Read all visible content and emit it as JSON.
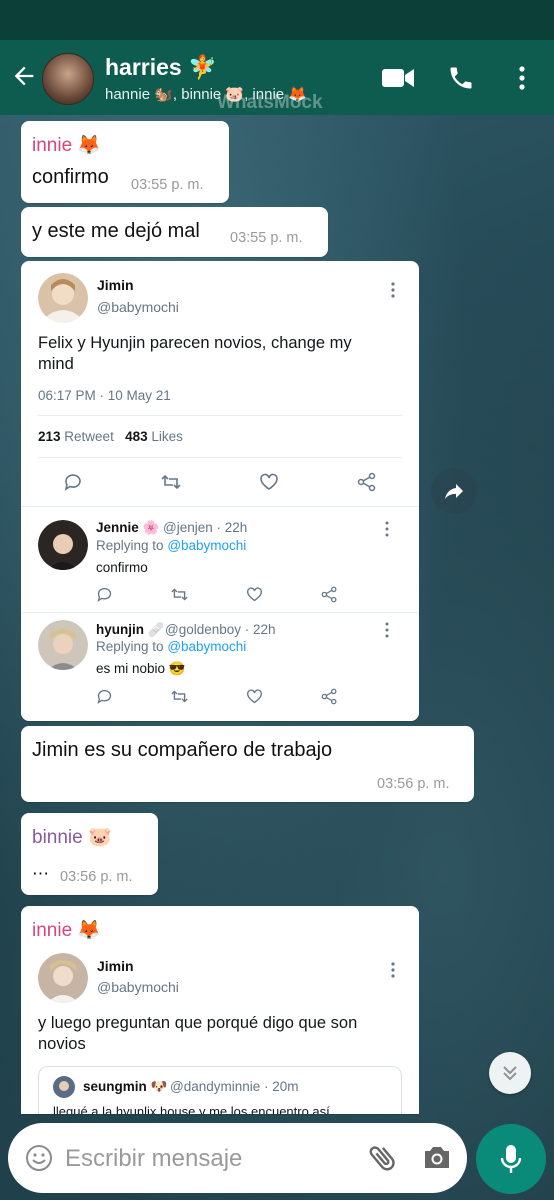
{
  "header": {
    "title": "harries 🧚",
    "subtitle": "hannie 🐿️, binnie 🐷, innie 🦊",
    "watermark": "WhatsMock"
  },
  "colors": {
    "header": "#0d5c4f",
    "status_bar": "#0b3f38",
    "innie_name": "#d6457e",
    "binnie_name": "#8b5a9e",
    "link": "#1da1f2",
    "mic_button": "#0a8a78"
  },
  "messages": {
    "m1": {
      "sender": "innie 🦊",
      "text": "confirmo",
      "time": "03:55 p. m."
    },
    "m2": {
      "text": "y este me dejó mal",
      "time": "03:55 p. m."
    },
    "m3": {
      "text": "Jimin es su compañero de trabajo",
      "time": "03:56 p. m."
    },
    "m4": {
      "sender": "binnie 🐷",
      "text": "⋯",
      "time": "03:56 p. m."
    },
    "m5": {
      "sender": "innie 🦊"
    }
  },
  "tweet1": {
    "name": "Jimin",
    "handle": "@babymochi",
    "text": "Felix y Hyunjin parecen novios, change my mind",
    "datetime": "06:17 PM · 10 May 21",
    "retweets": "213",
    "retweet_label": "Retweet",
    "likes": "483",
    "likes_label": "Likes",
    "replies": [
      {
        "name": "Jennie 🌸",
        "handle": "@jenjen · 22h",
        "replying": "Replying to",
        "replying_handle": "@babymochi",
        "text": "confirmo"
      },
      {
        "name": "hyunjin 🩹",
        "handle": "@goldenboy · 22h",
        "replying": "Replying to",
        "replying_handle": "@babymochi",
        "text": "es mi nobio 😎"
      }
    ]
  },
  "tweet2": {
    "name": "Jimin",
    "handle": "@babymochi",
    "text": "y luego preguntan que porqué digo que son novios",
    "quote": {
      "name": "seungmin 🐶",
      "handle": "@dandyminnie · 20m",
      "text": "llegué a la hyunlix house y me los encuentro así"
    }
  },
  "input": {
    "placeholder": "Escribir mensaje"
  }
}
